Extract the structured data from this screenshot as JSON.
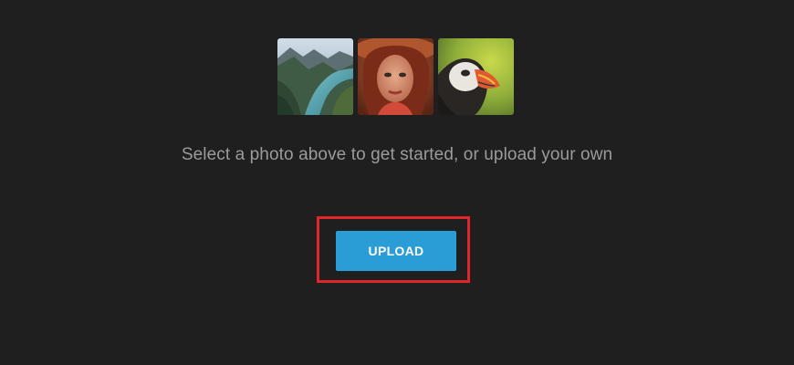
{
  "thumbnails": [
    {
      "name": "landscape-lake-photo",
      "alt": ""
    },
    {
      "name": "portrait-woman-hat-photo",
      "alt": ""
    },
    {
      "name": "puffin-bird-photo",
      "alt": ""
    }
  ],
  "prompt_text": "Select a photo above to get started, or upload your own",
  "upload_button_label": "UPLOAD",
  "colors": {
    "background": "#1f1f1f",
    "prompt_text": "#9b9b9b",
    "button": "#2b9dd6",
    "highlight": "#e0262a"
  }
}
